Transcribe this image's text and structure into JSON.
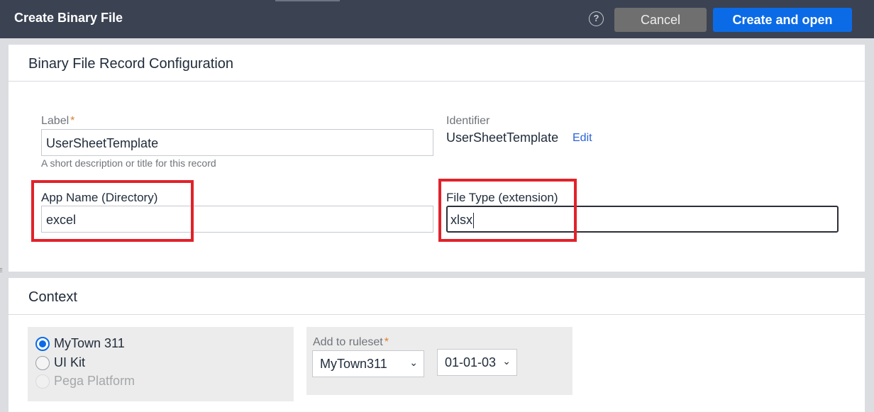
{
  "header": {
    "title": "Create Binary File",
    "help_glyph": "?",
    "cancel_label": "Cancel",
    "create_label": "Create and open"
  },
  "config_section": {
    "title": "Binary File Record Configuration",
    "label_field": {
      "label": "Label",
      "required_mark": "*",
      "value": "UserSheetTemplate",
      "hint": "A short description or title for this record"
    },
    "identifier": {
      "label": "Identifier",
      "value": "UserSheetTemplate",
      "edit_label": "Edit"
    },
    "app_name": {
      "label": "App Name (Directory)",
      "value": "excel"
    },
    "file_type": {
      "label": "File Type (extension)",
      "value": "xlsx"
    },
    "highlight_color": "#e1222a"
  },
  "context_section": {
    "title": "Context",
    "applications": [
      {
        "label": "MyTown 311",
        "selected": true,
        "disabled": false
      },
      {
        "label": "UI Kit",
        "selected": false,
        "disabled": false
      },
      {
        "label": "Pega Platform",
        "selected": false,
        "disabled": true
      }
    ],
    "ruleset": {
      "label": "Add to ruleset",
      "required_mark": "*",
      "name_value": "MyTown311",
      "version_value": "01-01-03"
    }
  },
  "icons": {
    "help": "help-circle-icon",
    "chevron": "chevron-down-icon"
  },
  "colors": {
    "header_bg": "#3b4252",
    "primary": "#0b6be7",
    "cancel_bg": "#6f6f6f",
    "required": "#e0802b",
    "link": "#2b62d6"
  }
}
